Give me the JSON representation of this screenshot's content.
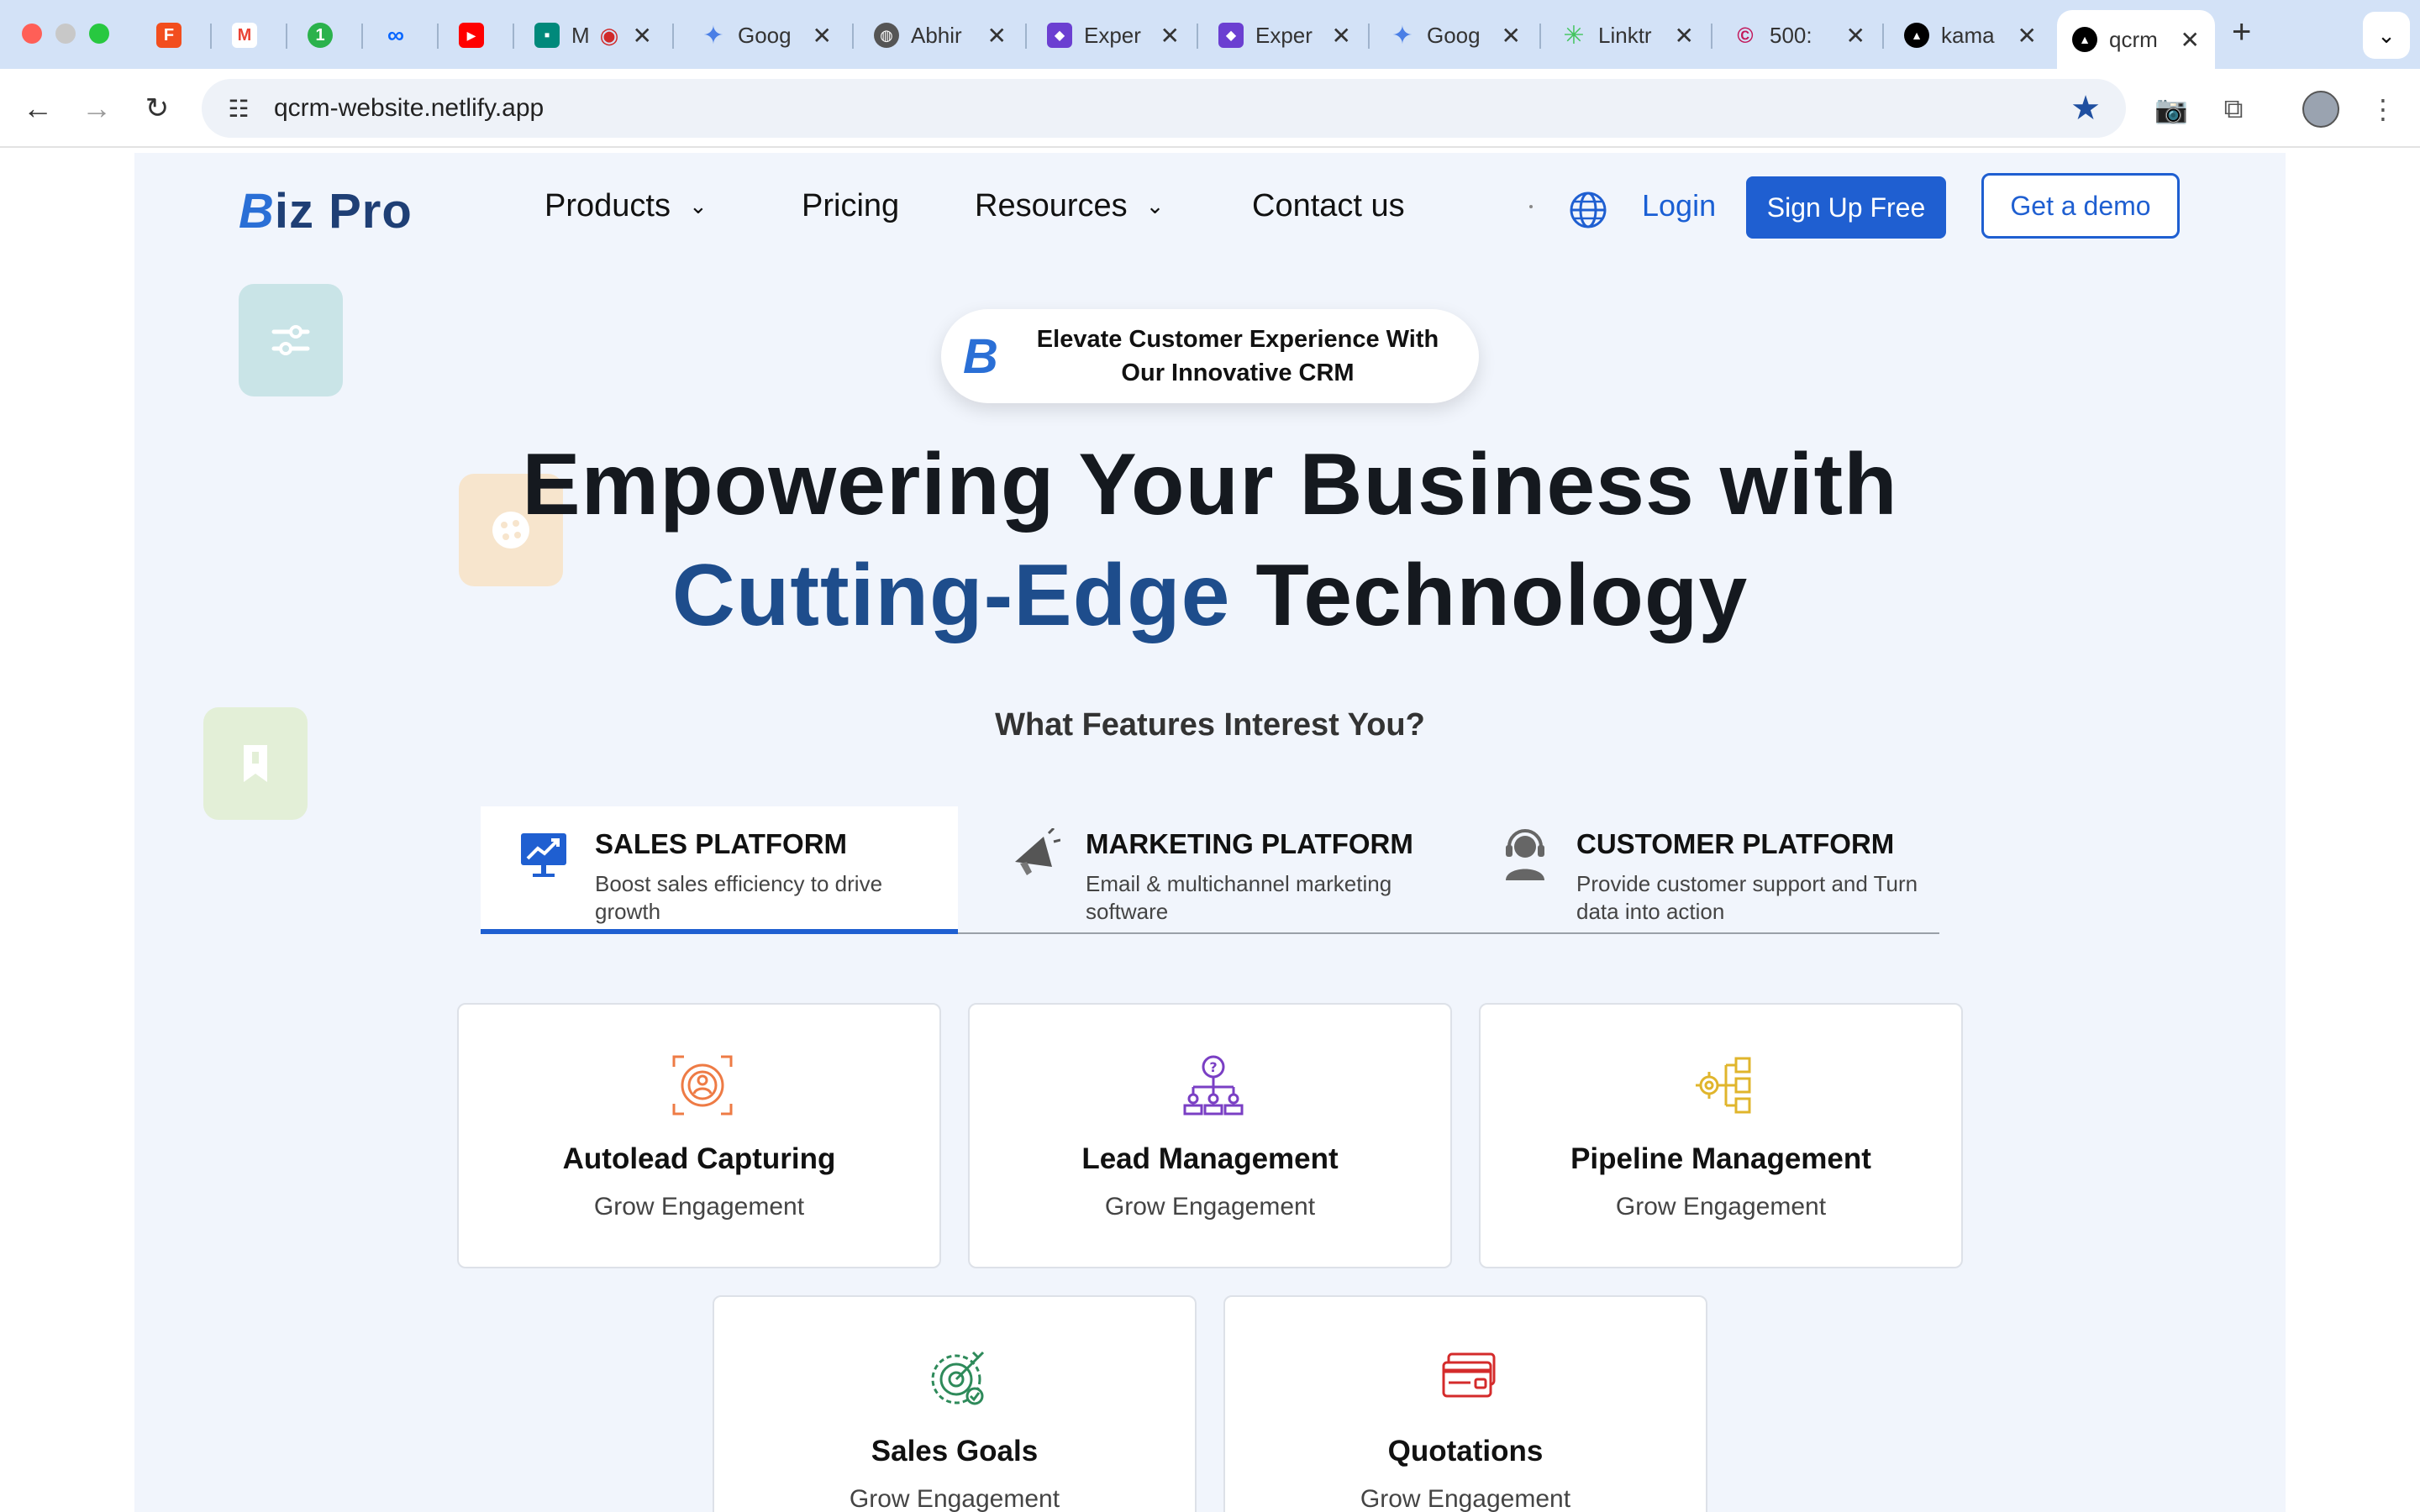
{
  "browser": {
    "tabs": [
      {
        "title": "",
        "icon": "figma-icon",
        "color": "#f24e1e"
      },
      {
        "title": "",
        "icon": "gmail-icon",
        "color": "#ea4335"
      },
      {
        "title": "",
        "icon": "badge-icon",
        "color": "#2bb24c",
        "badge": "1"
      },
      {
        "title": "",
        "icon": "meta-icon",
        "color": "#0866ff"
      },
      {
        "title": "",
        "icon": "youtube-icon",
        "color": "#ff0000"
      },
      {
        "title": "M",
        "icon": "meet-icon",
        "color": "#00897b"
      },
      {
        "title": "Goog",
        "icon": "gemini-icon",
        "color": "#4a7fe6"
      },
      {
        "title": "Abhir",
        "icon": "globe-icon",
        "color": "#555555"
      },
      {
        "title": "Exper",
        "icon": "app-icon",
        "color": "#6b3fd1"
      },
      {
        "title": "Exper",
        "icon": "app-icon",
        "color": "#6b3fd1"
      },
      {
        "title": "Goog",
        "icon": "gemini-icon",
        "color": "#4a7fe6"
      },
      {
        "title": "Linktr",
        "icon": "linktree-icon",
        "color": "#43e55e"
      },
      {
        "title": "500:",
        "icon": "error-icon",
        "color": "#c2185b"
      },
      {
        "title": "kama",
        "icon": "vercel-icon",
        "color": "#000000"
      },
      {
        "title": "qcrm",
        "icon": "vercel-icon",
        "color": "#000000"
      }
    ],
    "url": "qcrm-website.netlify.app"
  },
  "nav": {
    "logo_b": "B",
    "logo_rest": "iz Pro",
    "items": [
      {
        "label": "Products",
        "has_dropdown": true
      },
      {
        "label": "Pricing",
        "has_dropdown": false
      },
      {
        "label": "Resources",
        "has_dropdown": true
      },
      {
        "label": "Contact us",
        "has_dropdown": false
      }
    ],
    "login": "Login",
    "signup": "Sign Up Free",
    "demo": "Get a demo"
  },
  "badge_pill": {
    "logo": "B",
    "text_line1": "Elevate Customer Experience With",
    "text_line2": "Our Innovative CRM"
  },
  "hero": {
    "line1": "Empowering Your Business with",
    "line2_accent": "Cutting-Edge",
    "line2_rest": " Technology"
  },
  "features": {
    "heading": "What Features Interest You?",
    "tabs": [
      {
        "title": "SALES PLATFORM",
        "desc": "Boost sales efficiency to drive growth",
        "icon": "sales-chart-icon",
        "active": true
      },
      {
        "title": "MARKETING PLATFORM",
        "desc": "Email & multichannel marketing software",
        "icon": "megaphone-icon",
        "active": false
      },
      {
        "title": "CUSTOMER PLATFORM",
        "desc": "Provide customer support and Turn data into action",
        "icon": "support-agent-icon",
        "active": false
      }
    ],
    "cards": [
      {
        "title": "Autolead Capturing",
        "subtitle": "Grow Engagement",
        "icon": "target-user-icon",
        "color": "#ee7b45"
      },
      {
        "title": "Lead Management",
        "subtitle": "Grow Engagement",
        "icon": "org-chart-icon",
        "color": "#7a3fc4"
      },
      {
        "title": "Pipeline Management",
        "subtitle": "Grow Engagement",
        "icon": "pipeline-gear-icon",
        "color": "#e0b52c"
      },
      {
        "title": "Sales Goals",
        "subtitle": "Grow Engagement",
        "icon": "goal-target-icon",
        "color": "#2e8a5a"
      },
      {
        "title": "Quotations",
        "subtitle": "Grow Engagement",
        "icon": "cards-icon",
        "color": "#d42b2b"
      }
    ]
  },
  "colors": {
    "primary": "#1f5fd1",
    "accent_text": "#1e4d8c",
    "page_bg": "#f1f5fc"
  }
}
